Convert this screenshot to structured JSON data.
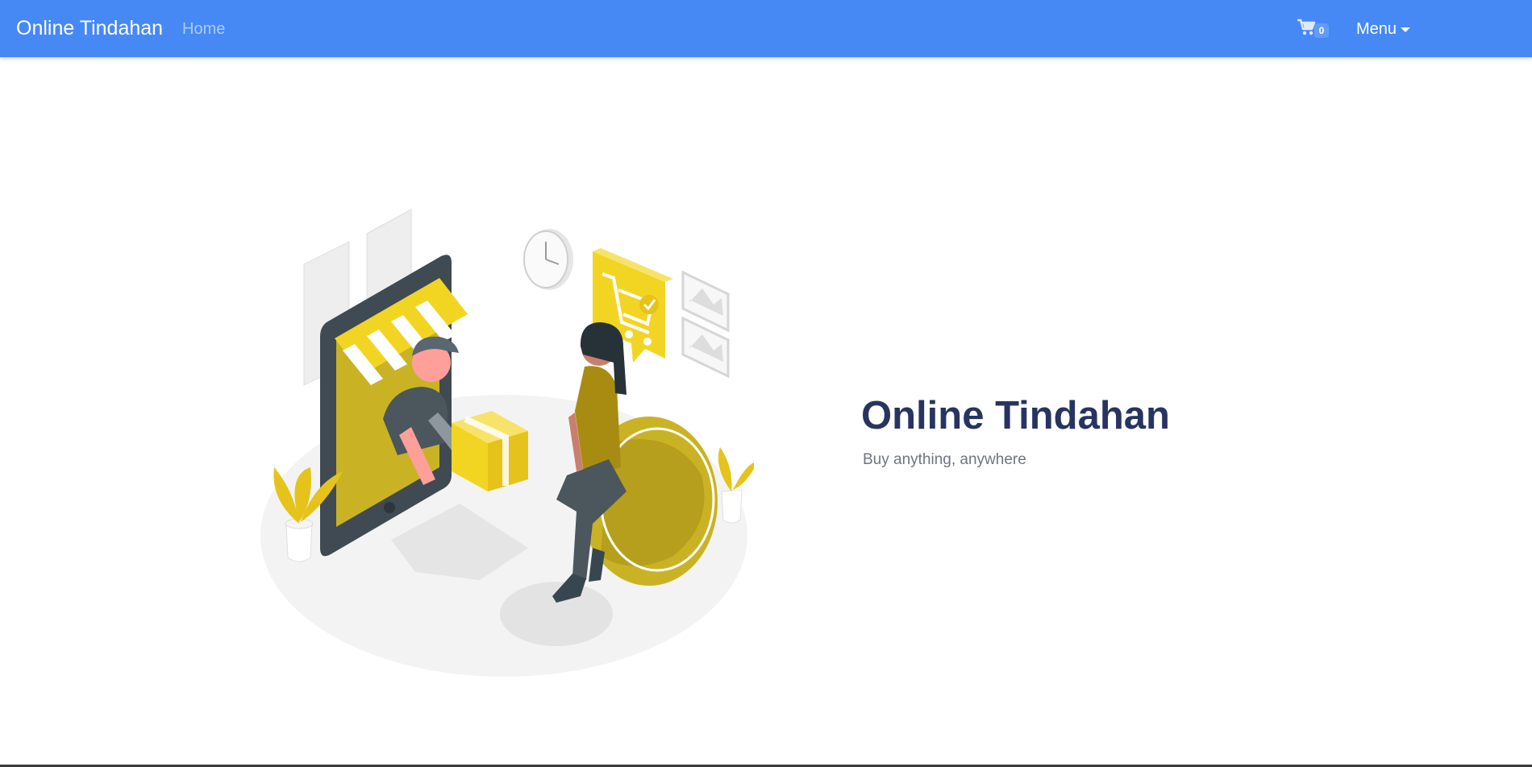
{
  "navbar": {
    "brand": "Online Tindahan",
    "home_link": "Home",
    "cart": {
      "icon": "cart-icon",
      "count": "0"
    },
    "menu_label": "Menu",
    "background": "#4689f5"
  },
  "hero": {
    "title": "Online Tindahan",
    "subtitle": "Buy anything, anywhere",
    "title_color": "#283460",
    "illustration_accent": "#f2d523"
  }
}
